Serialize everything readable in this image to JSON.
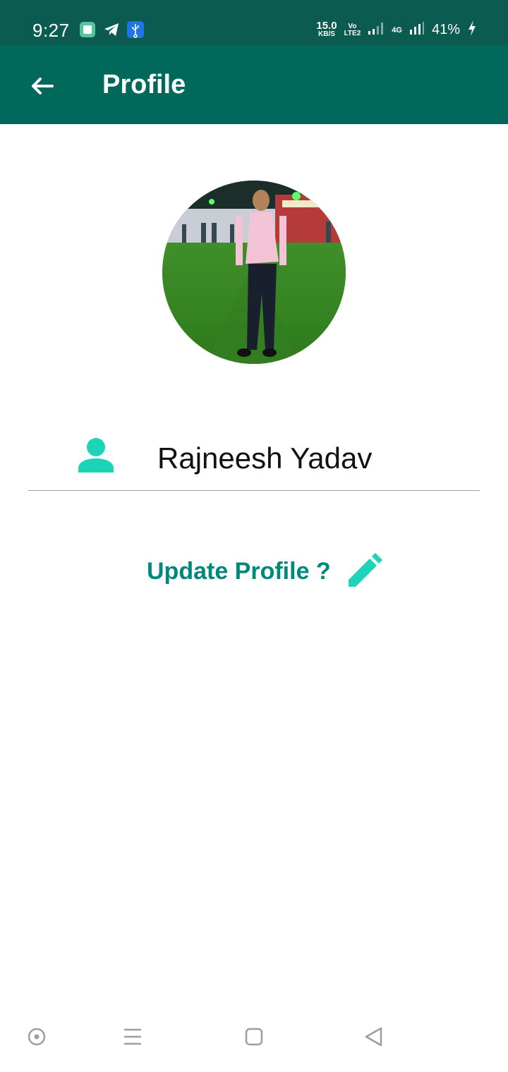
{
  "status_bar": {
    "time": "9:27",
    "net_speed_value": "15.0",
    "net_speed_unit": "KB/S",
    "volte_top": "Vo",
    "volte_bottom": "LTE2",
    "network_type": "4G",
    "battery": "41%",
    "notification_icons": [
      "app-square-icon",
      "telegram-icon",
      "usb-icon"
    ]
  },
  "app_bar": {
    "title": "Profile",
    "background_color": "#00695c"
  },
  "profile": {
    "name": "Rajneesh Yadav",
    "update_label": "Update Profile ?",
    "accent_color": "#1dd3b8"
  },
  "nav_bar": {
    "icons": [
      "screenshot-circle-icon",
      "menu-icon",
      "home-icon",
      "back-triangle-icon"
    ]
  }
}
